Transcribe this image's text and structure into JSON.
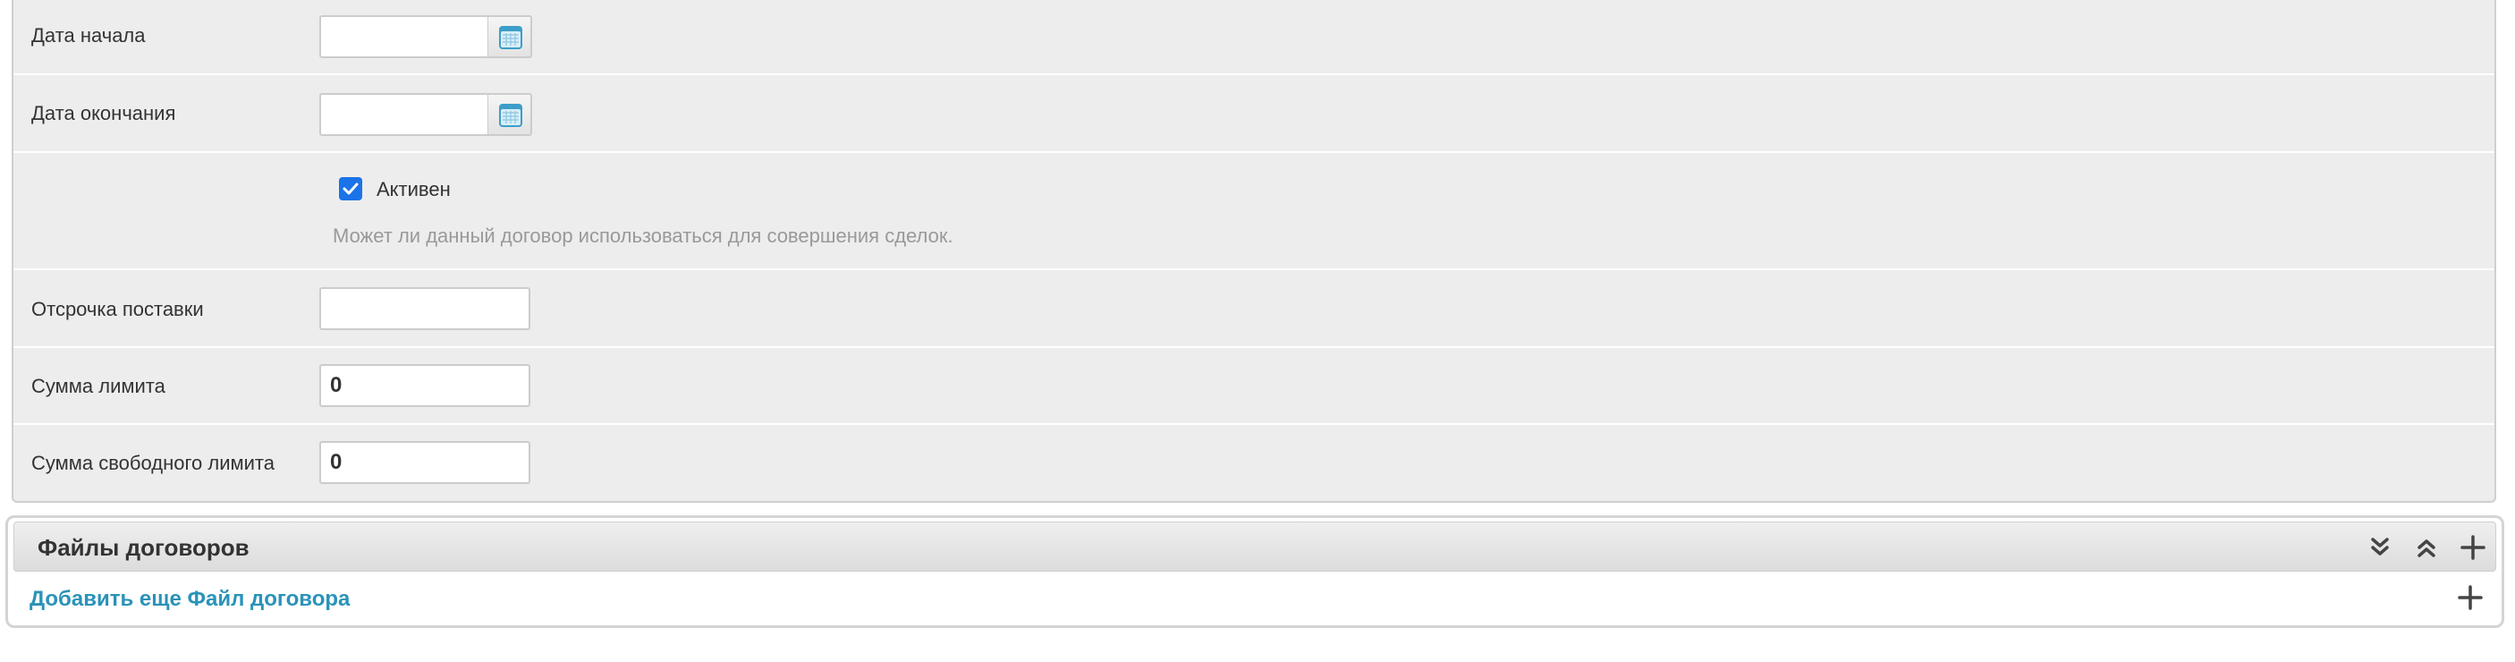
{
  "form": {
    "start_date": {
      "label": "Дата начала",
      "value": ""
    },
    "end_date": {
      "label": "Дата окончания",
      "value": ""
    },
    "active": {
      "label": "Активен",
      "checked": true,
      "hint": "Может ли данный договор использоваться для совершения сделок."
    },
    "delivery_delay": {
      "label": "Отсрочка поставки",
      "value": ""
    },
    "limit_sum": {
      "label": "Сумма лимита",
      "value": "0"
    },
    "free_limit_sum": {
      "label": "Сумма свободного лимита",
      "value": "0"
    }
  },
  "files_section": {
    "title": "Файлы договоров",
    "add_link": "Добавить еще Файл договора",
    "icons": [
      "chevrons-down-icon",
      "chevrons-up-icon",
      "plus-icon"
    ]
  },
  "colors": {
    "form_bg": "#ededed",
    "link": "#2a93b8",
    "checkbox": "#1a73e8",
    "calendar_icon": "#3d9ec9"
  }
}
